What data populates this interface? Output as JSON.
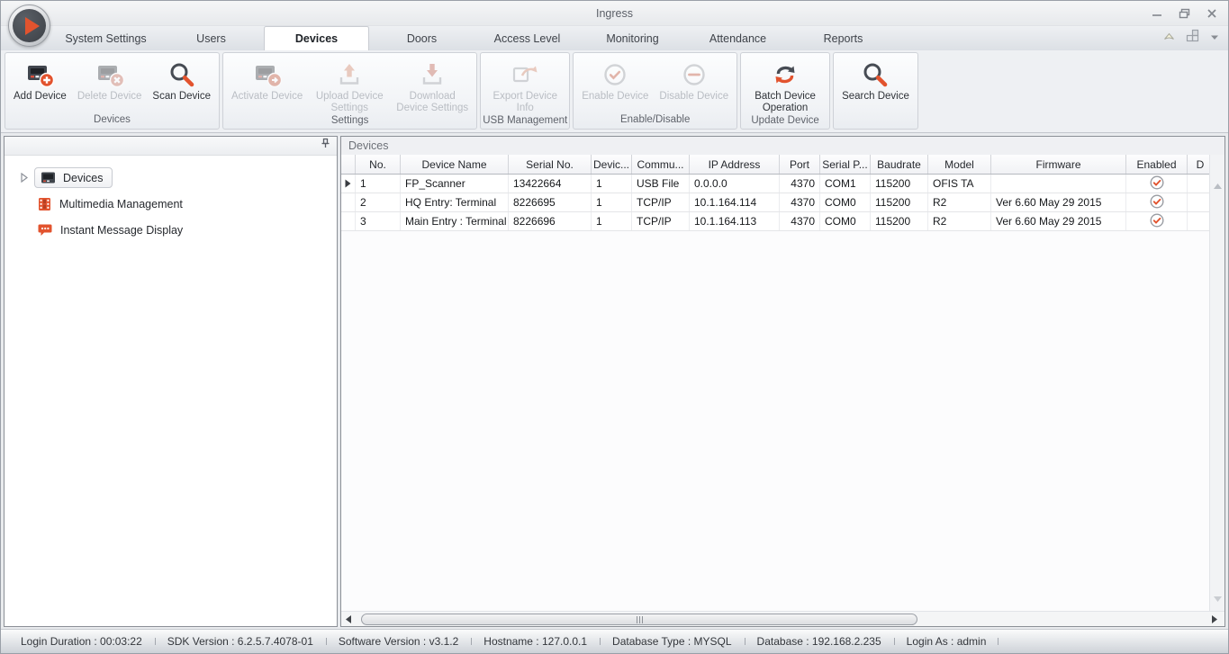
{
  "window": {
    "title": "Ingress",
    "controls": [
      "minimize",
      "restore",
      "close"
    ]
  },
  "tabs": [
    {
      "label": "System Settings",
      "active": false
    },
    {
      "label": "Users",
      "active": false
    },
    {
      "label": "Devices",
      "active": true
    },
    {
      "label": "Doors",
      "active": false
    },
    {
      "label": "Access Level",
      "active": false
    },
    {
      "label": "Monitoring",
      "active": false
    },
    {
      "label": "Attendance",
      "active": false
    },
    {
      "label": "Reports",
      "active": false
    }
  ],
  "ribbon": {
    "groups": [
      {
        "label": "Devices",
        "buttons": [
          {
            "label": "Add Device",
            "icon": "add-device-icon",
            "enabled": true
          },
          {
            "label": "Delete Device",
            "icon": "delete-device-icon",
            "enabled": false
          },
          {
            "label": "Scan Device",
            "icon": "scan-device-icon",
            "enabled": true
          }
        ]
      },
      {
        "label": "Settings",
        "buttons": [
          {
            "label": "Activate Device",
            "icon": "activate-device-icon",
            "enabled": false
          },
          {
            "label": "Upload Device Settings",
            "icon": "upload-device-settings-icon",
            "enabled": false
          },
          {
            "label": "Download Device Settings",
            "icon": "download-device-settings-icon",
            "enabled": false
          }
        ]
      },
      {
        "label": "USB Management",
        "buttons": [
          {
            "label": "Export Device Info",
            "icon": "export-device-info-icon",
            "enabled": false
          }
        ]
      },
      {
        "label": "Enable/Disable",
        "buttons": [
          {
            "label": "Enable Device",
            "icon": "enable-device-icon",
            "enabled": false
          },
          {
            "label": "Disable Device",
            "icon": "disable-device-icon",
            "enabled": false
          }
        ]
      },
      {
        "label": "Update Device",
        "buttons": [
          {
            "label": "Batch Device Operation",
            "icon": "batch-device-operation-icon",
            "enabled": true
          }
        ]
      },
      {
        "label": "",
        "buttons": [
          {
            "label": "Search Device",
            "icon": "search-device-icon",
            "enabled": true
          }
        ]
      }
    ]
  },
  "sidebar": {
    "items": [
      {
        "label": "Devices",
        "icon": "device-icon",
        "selected": true,
        "expandable": true
      },
      {
        "label": "Multimedia Management",
        "icon": "multimedia-icon",
        "selected": false,
        "expandable": false
      },
      {
        "label": "Instant Message Display",
        "icon": "instant-message-icon",
        "selected": false,
        "expandable": false
      }
    ]
  },
  "main": {
    "panel_title": "Devices",
    "table": {
      "columns": [
        "No.",
        "Device Name",
        "Serial No.",
        "Devic...",
        "Commu...",
        "IP Address",
        "Port",
        "Serial P...",
        "Baudrate",
        "Model",
        "Firmware",
        "Enabled",
        "D"
      ],
      "rows": [
        {
          "cells": [
            "1",
            "FP_Scanner",
            "13422664",
            "1",
            "USB File",
            "0.0.0.0",
            "4370",
            "COM1",
            "115200",
            "OFIS TA",
            ""
          ],
          "enabled": true,
          "selected": true
        },
        {
          "cells": [
            "2",
            "HQ Entry: Terminal",
            "8226695",
            "1",
            "TCP/IP",
            "10.1.164.114",
            "4370",
            "COM0",
            "115200",
            "R2",
            "Ver 6.60 May 29 2015"
          ],
          "enabled": true,
          "selected": false
        },
        {
          "cells": [
            "3",
            "Main Entry : Terminal",
            "8226696",
            "1",
            "TCP/IP",
            "10.1.164.113",
            "4370",
            "COM0",
            "115200",
            "R2",
            "Ver 6.60 May 29 2015"
          ],
          "enabled": true,
          "selected": false
        }
      ]
    }
  },
  "statusbar": {
    "items": [
      "Login Duration : 00:03:22",
      "SDK Version : 6.2.5.7.4078-01",
      "Software Version : v3.1.2",
      "Hostname : 127.0.0.1",
      "Database Type : MYSQL",
      "Database : 192.168.2.235",
      "Login As : admin"
    ]
  },
  "colors": {
    "accent": "#e2532e",
    "icon_dark": "#474c54",
    "disabled_text": "#b9bdc3",
    "panel_border": "#8b8f96"
  }
}
